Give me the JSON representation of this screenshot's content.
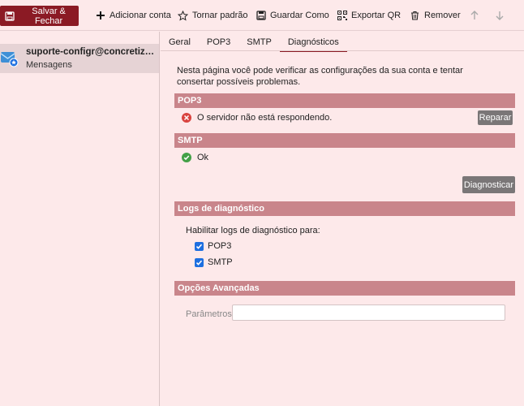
{
  "toolbar": {
    "save_close": "Salvar & Fechar",
    "add_account": "Adicionar conta",
    "make_default": "Tornar padrão",
    "save_as": "Guardar Como",
    "export_qr": "Exportar QR",
    "remove": "Remover"
  },
  "sidebar": {
    "account": {
      "name": "suporte-configr@concretizarco...",
      "subtitle": "Mensagens"
    }
  },
  "tabs": [
    {
      "label": "Geral",
      "active": false
    },
    {
      "label": "POP3",
      "active": false
    },
    {
      "label": "SMTP",
      "active": false
    },
    {
      "label": "Diagnósticos",
      "active": true
    }
  ],
  "main": {
    "intro": "Nesta página você pode verificar as configurações da sua conta e tentar consertar possíveis problemas.",
    "pop3": {
      "header": "POP3",
      "status": "O servidor não está respondendo.",
      "status_type": "error",
      "repair_label": "Reparar"
    },
    "smtp": {
      "header": "SMTP",
      "status": "Ok",
      "status_type": "ok"
    },
    "diagnose_label": "Diagnosticar",
    "logs": {
      "header": "Logs de diagnóstico",
      "enable_label": "Habilitar logs de diagnóstico para:",
      "options": [
        {
          "label": "POP3",
          "checked": true
        },
        {
          "label": "SMTP",
          "checked": true
        }
      ]
    },
    "advanced": {
      "header": "Opções Avançadas",
      "params_label": "Parâmetros:",
      "params_value": "",
      "params_placeholder": ""
    }
  },
  "colors": {
    "accent": "#8b1a24",
    "section": "#c9858b",
    "background": "#fde9ea",
    "error": "#d9433f",
    "ok": "#43a047",
    "checkbox": "#1d6fe0"
  }
}
